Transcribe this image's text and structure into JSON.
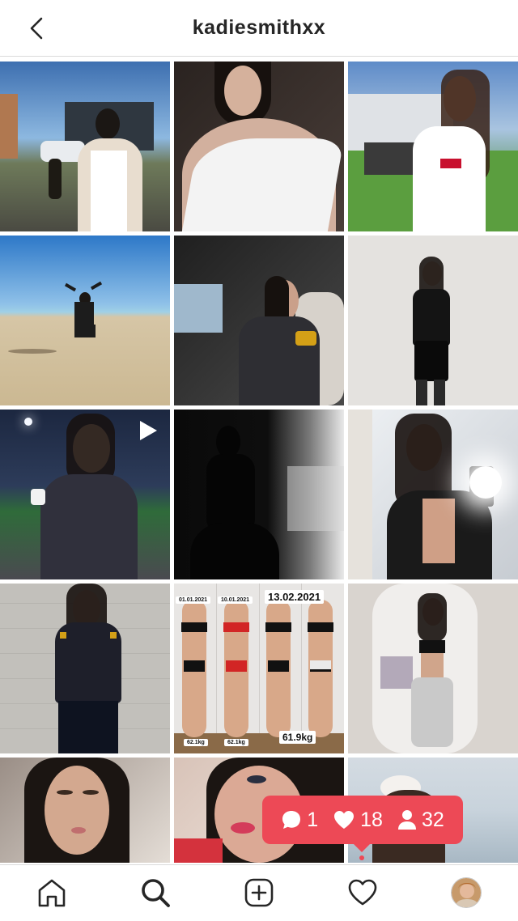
{
  "header": {
    "username": "kadiesmithxx",
    "back_icon": "chevron-left-icon"
  },
  "posts": [
    {
      "id": "post-1",
      "desc": "outdoor-selfie",
      "bg": "#4f6d8f"
    },
    {
      "id": "post-2",
      "desc": "white-top",
      "bg": "#3a3230"
    },
    {
      "id": "post-3",
      "desc": "levis-tee",
      "bg": "#6f8fb0"
    },
    {
      "id": "post-4",
      "desc": "beach-jump",
      "bg": "#8fb6d8"
    },
    {
      "id": "post-5",
      "desc": "car-seat",
      "bg": "#3b3b3b"
    },
    {
      "id": "post-6",
      "desc": "black-outfit",
      "bg": "#e5e3e1"
    },
    {
      "id": "post-7",
      "desc": "sports-field",
      "bg": "#2a3346",
      "is_video": true
    },
    {
      "id": "post-8",
      "desc": "silhouette",
      "bg": "#0e0e0e"
    },
    {
      "id": "post-9",
      "desc": "mirror-selfie",
      "bg": "#c9cfd6"
    },
    {
      "id": "post-10",
      "desc": "brick-wall",
      "bg": "#b9b7b2"
    },
    {
      "id": "post-11",
      "desc": "progress-photos",
      "bg": "#e8e6e4",
      "labels": [
        "01.01.2021",
        "10.01.2021",
        "13.02.2021",
        "62.1kg",
        "62.1kg",
        "61.9kg"
      ]
    },
    {
      "id": "post-12",
      "desc": "home-mirror",
      "bg": "#d8d3cf"
    },
    {
      "id": "post-13",
      "desc": "closeup-1",
      "bg": "#b49a8c"
    },
    {
      "id": "post-14",
      "desc": "closeup-2",
      "bg": "#c9a89a"
    },
    {
      "id": "post-15",
      "desc": "seaside",
      "bg": "#cdd7df"
    }
  ],
  "activity": {
    "comments": "1",
    "likes": "18",
    "follows": "32",
    "color": "#ed4956"
  },
  "bottom_nav": {
    "items": [
      "home-icon",
      "search-icon",
      "add-post-icon",
      "heart-icon",
      "profile-avatar"
    ]
  }
}
